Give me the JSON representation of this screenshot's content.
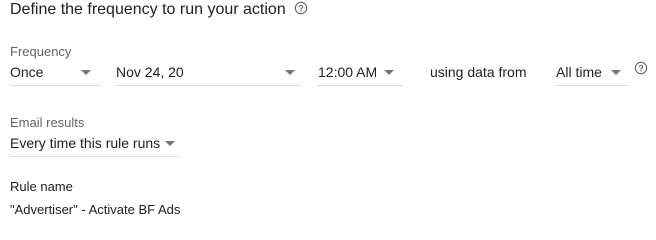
{
  "header": {
    "title": "Define the frequency to run your action",
    "help_icon": "help-circle-icon"
  },
  "frequency": {
    "label": "Frequency",
    "type_value": "Once",
    "date_value": "Nov 24, 20",
    "time_value": "12:00 AM",
    "using_text": "using data from",
    "range_value": "All time",
    "help_icon": "help-circle-icon"
  },
  "email": {
    "label": "Email results",
    "value": "Every time this rule runs"
  },
  "rule": {
    "label": "Rule name",
    "value": "\"Advertiser\" - Activate BF Ads"
  },
  "colors": {
    "text": "#202124",
    "label": "#5f6368",
    "underline": "#dadce0",
    "caret": "#70757a"
  }
}
